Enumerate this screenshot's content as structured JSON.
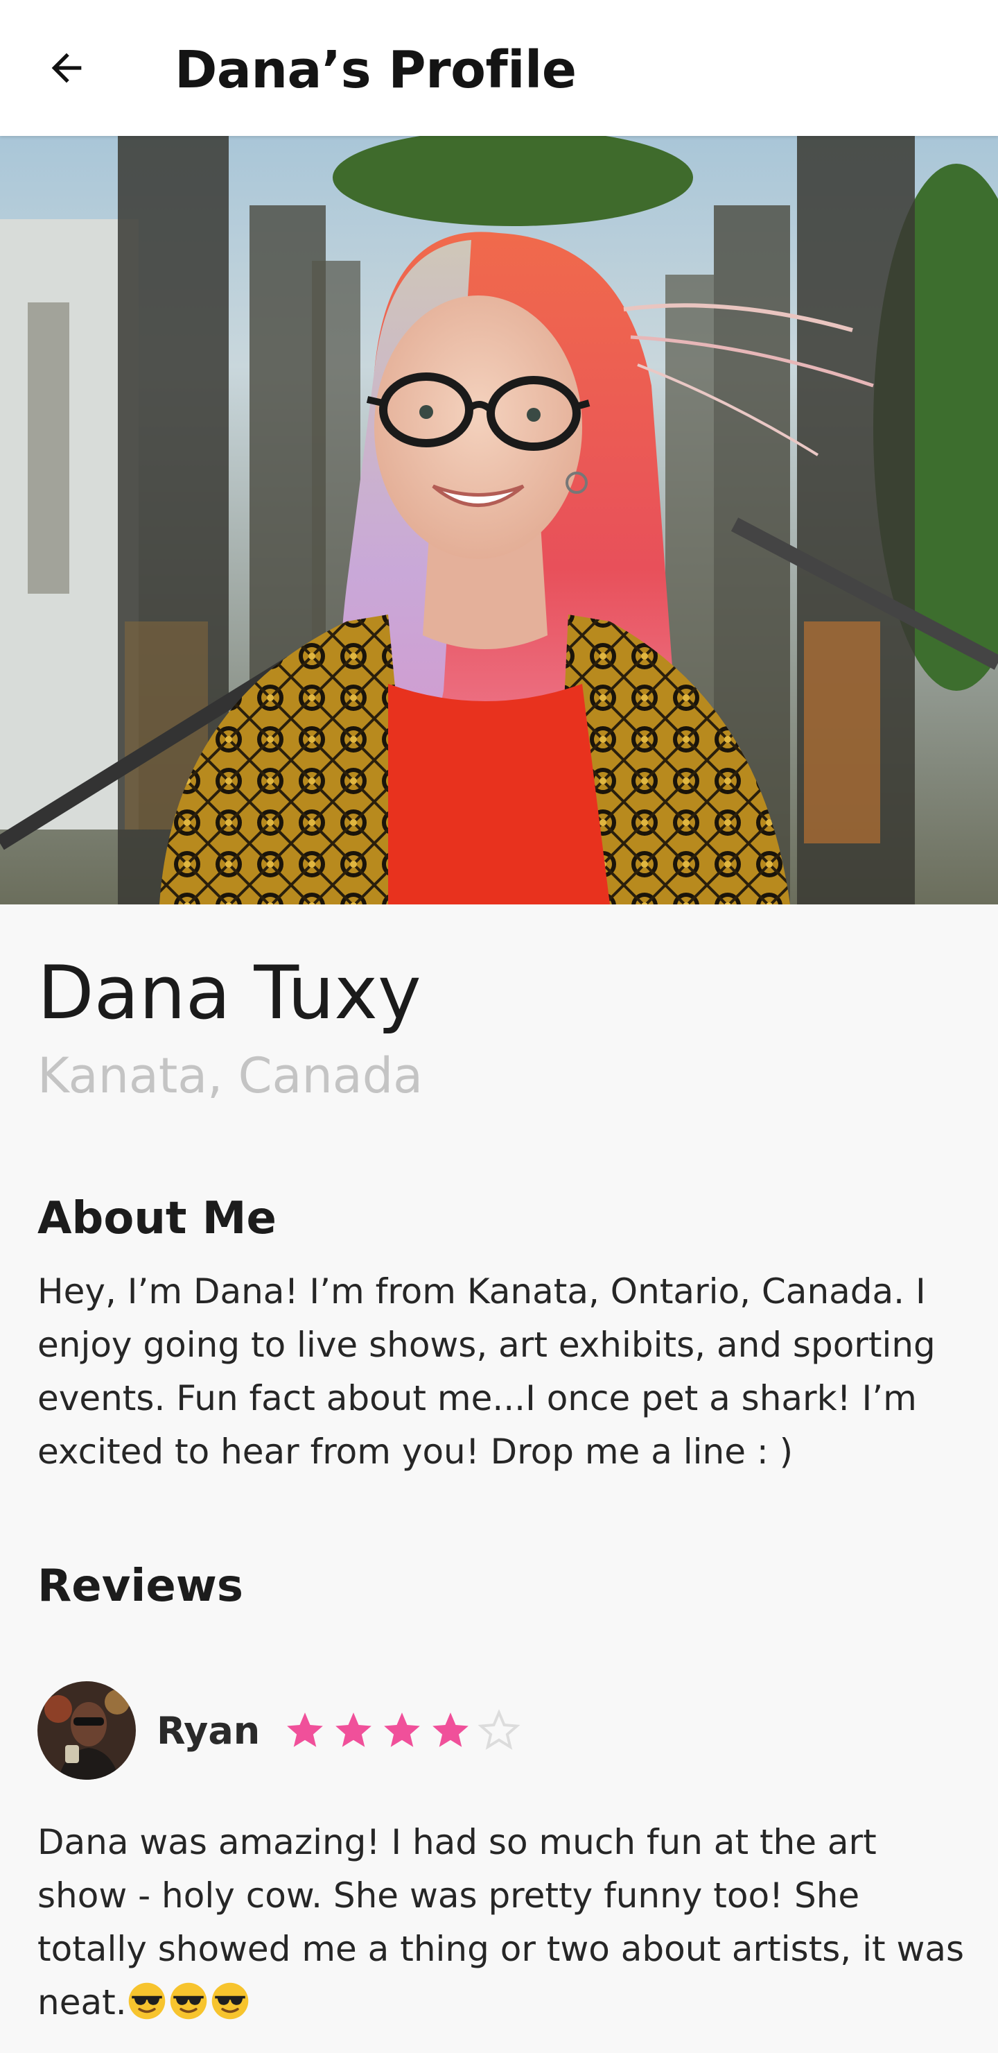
{
  "app_bar": {
    "title": "Dana’s Profile",
    "back_icon": "arrow-left-icon"
  },
  "hero": {
    "image": "profile-photo"
  },
  "profile": {
    "name": "Dana Tuxy",
    "location": "Kanata, Canada"
  },
  "about": {
    "heading": "About Me",
    "text": "Hey, I’m Dana! I’m from Kanata, Ontario, Canada. I enjoy going to live shows, art exhibits, and sporting events. Fun fact about me...I once pet a shark! I’m excited to hear from you! Drop me a line : )"
  },
  "reviews": {
    "heading": "Reviews",
    "items": [
      {
        "reviewer": "Ryan",
        "rating": 4,
        "max_rating": 5,
        "text": "Dana was amazing! I had so much fun at the art show - holy cow. She was pretty funny too! She totally showed me a thing or  two about artists, it was neat.",
        "emoji_icons": [
          "sunglasses-face-icon",
          "sunglasses-face-icon",
          "sunglasses-face-icon"
        ]
      }
    ]
  },
  "colors": {
    "star_filled": "#f0509a",
    "star_empty": "#dcdcdc",
    "location_text": "#c4c4c4",
    "background": "#f8f8f8"
  }
}
